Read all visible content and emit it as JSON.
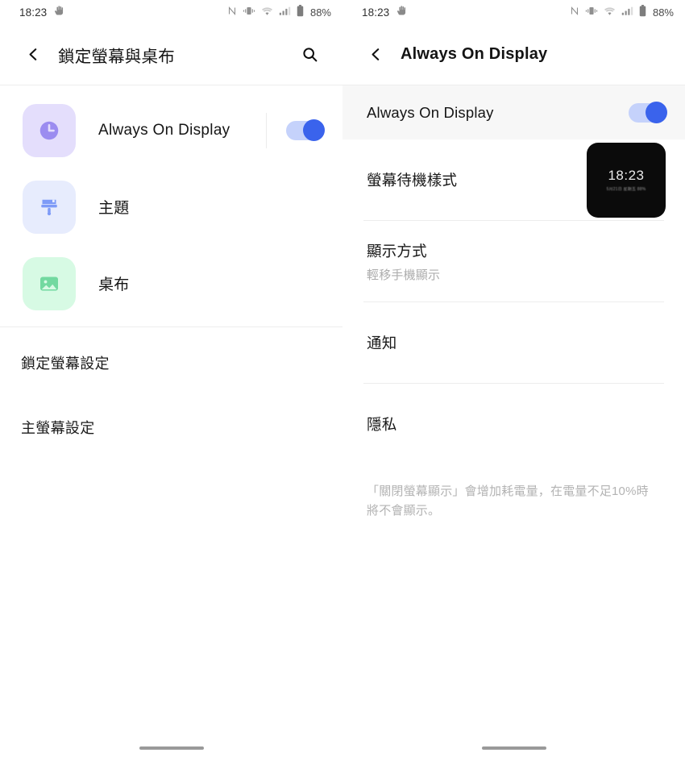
{
  "status_bar": {
    "time": "18:23",
    "battery_percent": "88%",
    "icons": [
      "hand-gesture-icon",
      "nfc-icon",
      "vibrate-icon",
      "wifi-icon",
      "signal-icon",
      "battery-icon"
    ]
  },
  "left_screen": {
    "app_bar": {
      "back_icon": "chevron-left-icon",
      "title": "鎖定螢幕與桌布",
      "search_icon": "search-icon"
    },
    "tiles": [
      {
        "label": "Always On Display",
        "icon": "clock-icon",
        "tile_bg": "#E4DEFC",
        "icon_color": "#9B8CF0",
        "has_switch": true,
        "switch_on": true
      },
      {
        "label": "主題",
        "icon": "paintbrush-icon",
        "tile_bg": "#E7ECFD",
        "icon_color": "#7E9BF7",
        "has_switch": false,
        "switch_on": false
      },
      {
        "label": "桌布",
        "icon": "image-icon",
        "tile_bg": "#D7FAE4",
        "icon_color": "#72D9A0",
        "has_switch": false,
        "switch_on": false
      }
    ],
    "plain_rows": [
      {
        "label": "鎖定螢幕設定"
      },
      {
        "label": "主螢幕設定"
      }
    ]
  },
  "right_screen": {
    "app_bar": {
      "back_icon": "chevron-left-icon",
      "title": "Always On Display"
    },
    "master_toggle": {
      "label": "Always On Display",
      "switch_on": true
    },
    "rows": [
      {
        "title": "螢幕待機樣式",
        "subtitle": "",
        "thumbnail": {
          "time": "18:23",
          "sub": "5月21日 星期五  88%"
        }
      },
      {
        "title": "顯示方式",
        "subtitle": "輕移手機顯示",
        "thumbnail": null
      },
      {
        "title": "通知",
        "subtitle": "",
        "thumbnail": null
      },
      {
        "title": "隱私",
        "subtitle": "",
        "thumbnail": null
      }
    ],
    "footnote": "「關閉螢幕顯示」會增加耗電量，在電量不足10%時將不會顯示。"
  },
  "colors": {
    "accent": "#3A63EC",
    "switch_track": "#C5D2FB",
    "highlight_row_bg": "#F7F7F7",
    "divider": "#EDEDED",
    "subtitle_text": "#ACACAC"
  }
}
